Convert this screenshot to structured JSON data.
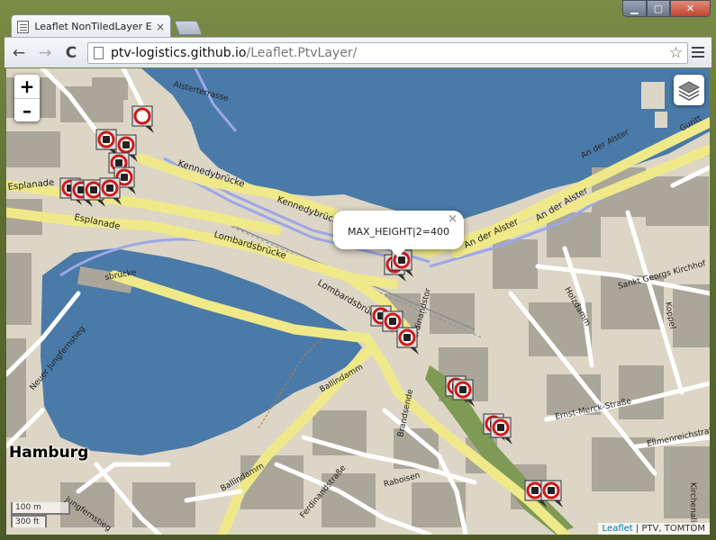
{
  "browser": {
    "tab_title": "Leaflet NonTiledLayer Exa",
    "tab_close": "×",
    "url_host": "ptv-logistics.github.io",
    "url_path": "/Leaflet.PtvLayer/",
    "back": "←",
    "forward": "→",
    "reload": "C",
    "bookmark": "☆",
    "min": "▁",
    "max": "▢",
    "close": "✕"
  },
  "map": {
    "zoom_in": "+",
    "zoom_out": "–",
    "popup_text": "MAX_HEIGHT|2=400",
    "popup_close": "×",
    "city_label": "Hamburg",
    "scale_metric": "100 m",
    "scale_imperial": "300 ft",
    "attribution_leaflet": "Leaflet",
    "attribution_sep": " | ",
    "attribution_rest": "PTV, TOMTOM",
    "street_labels": [
      "Kennedybrücke",
      "Esplanade",
      "Esplanade",
      "Lombardsbrücke",
      "Lombardsbrücke",
      "An der Alster",
      "An der Alster",
      "Ballindamm",
      "Ballindamm",
      "Brandsende",
      "Ferdinandstraße",
      "Raboisen",
      "Jungfernstieg",
      "Neuer Jungfernstieg",
      "Holzdamm",
      "Sankt Georgs Kirchhof",
      "Ernst-Merck-Straße",
      "Ellmenreichstraße",
      "Kirchenallee",
      "Koppel",
      "Alsterterrasse",
      "Ferdinandstor",
      "Guritt"
    ],
    "colors": {
      "water": "#4a7aa8",
      "land": "#ddd6c6",
      "block": "#aba69a",
      "major_road": "#f0e98a",
      "minor_road": "#ffffff",
      "rail": "#9ca7e8",
      "park": "#7e9a55"
    }
  }
}
